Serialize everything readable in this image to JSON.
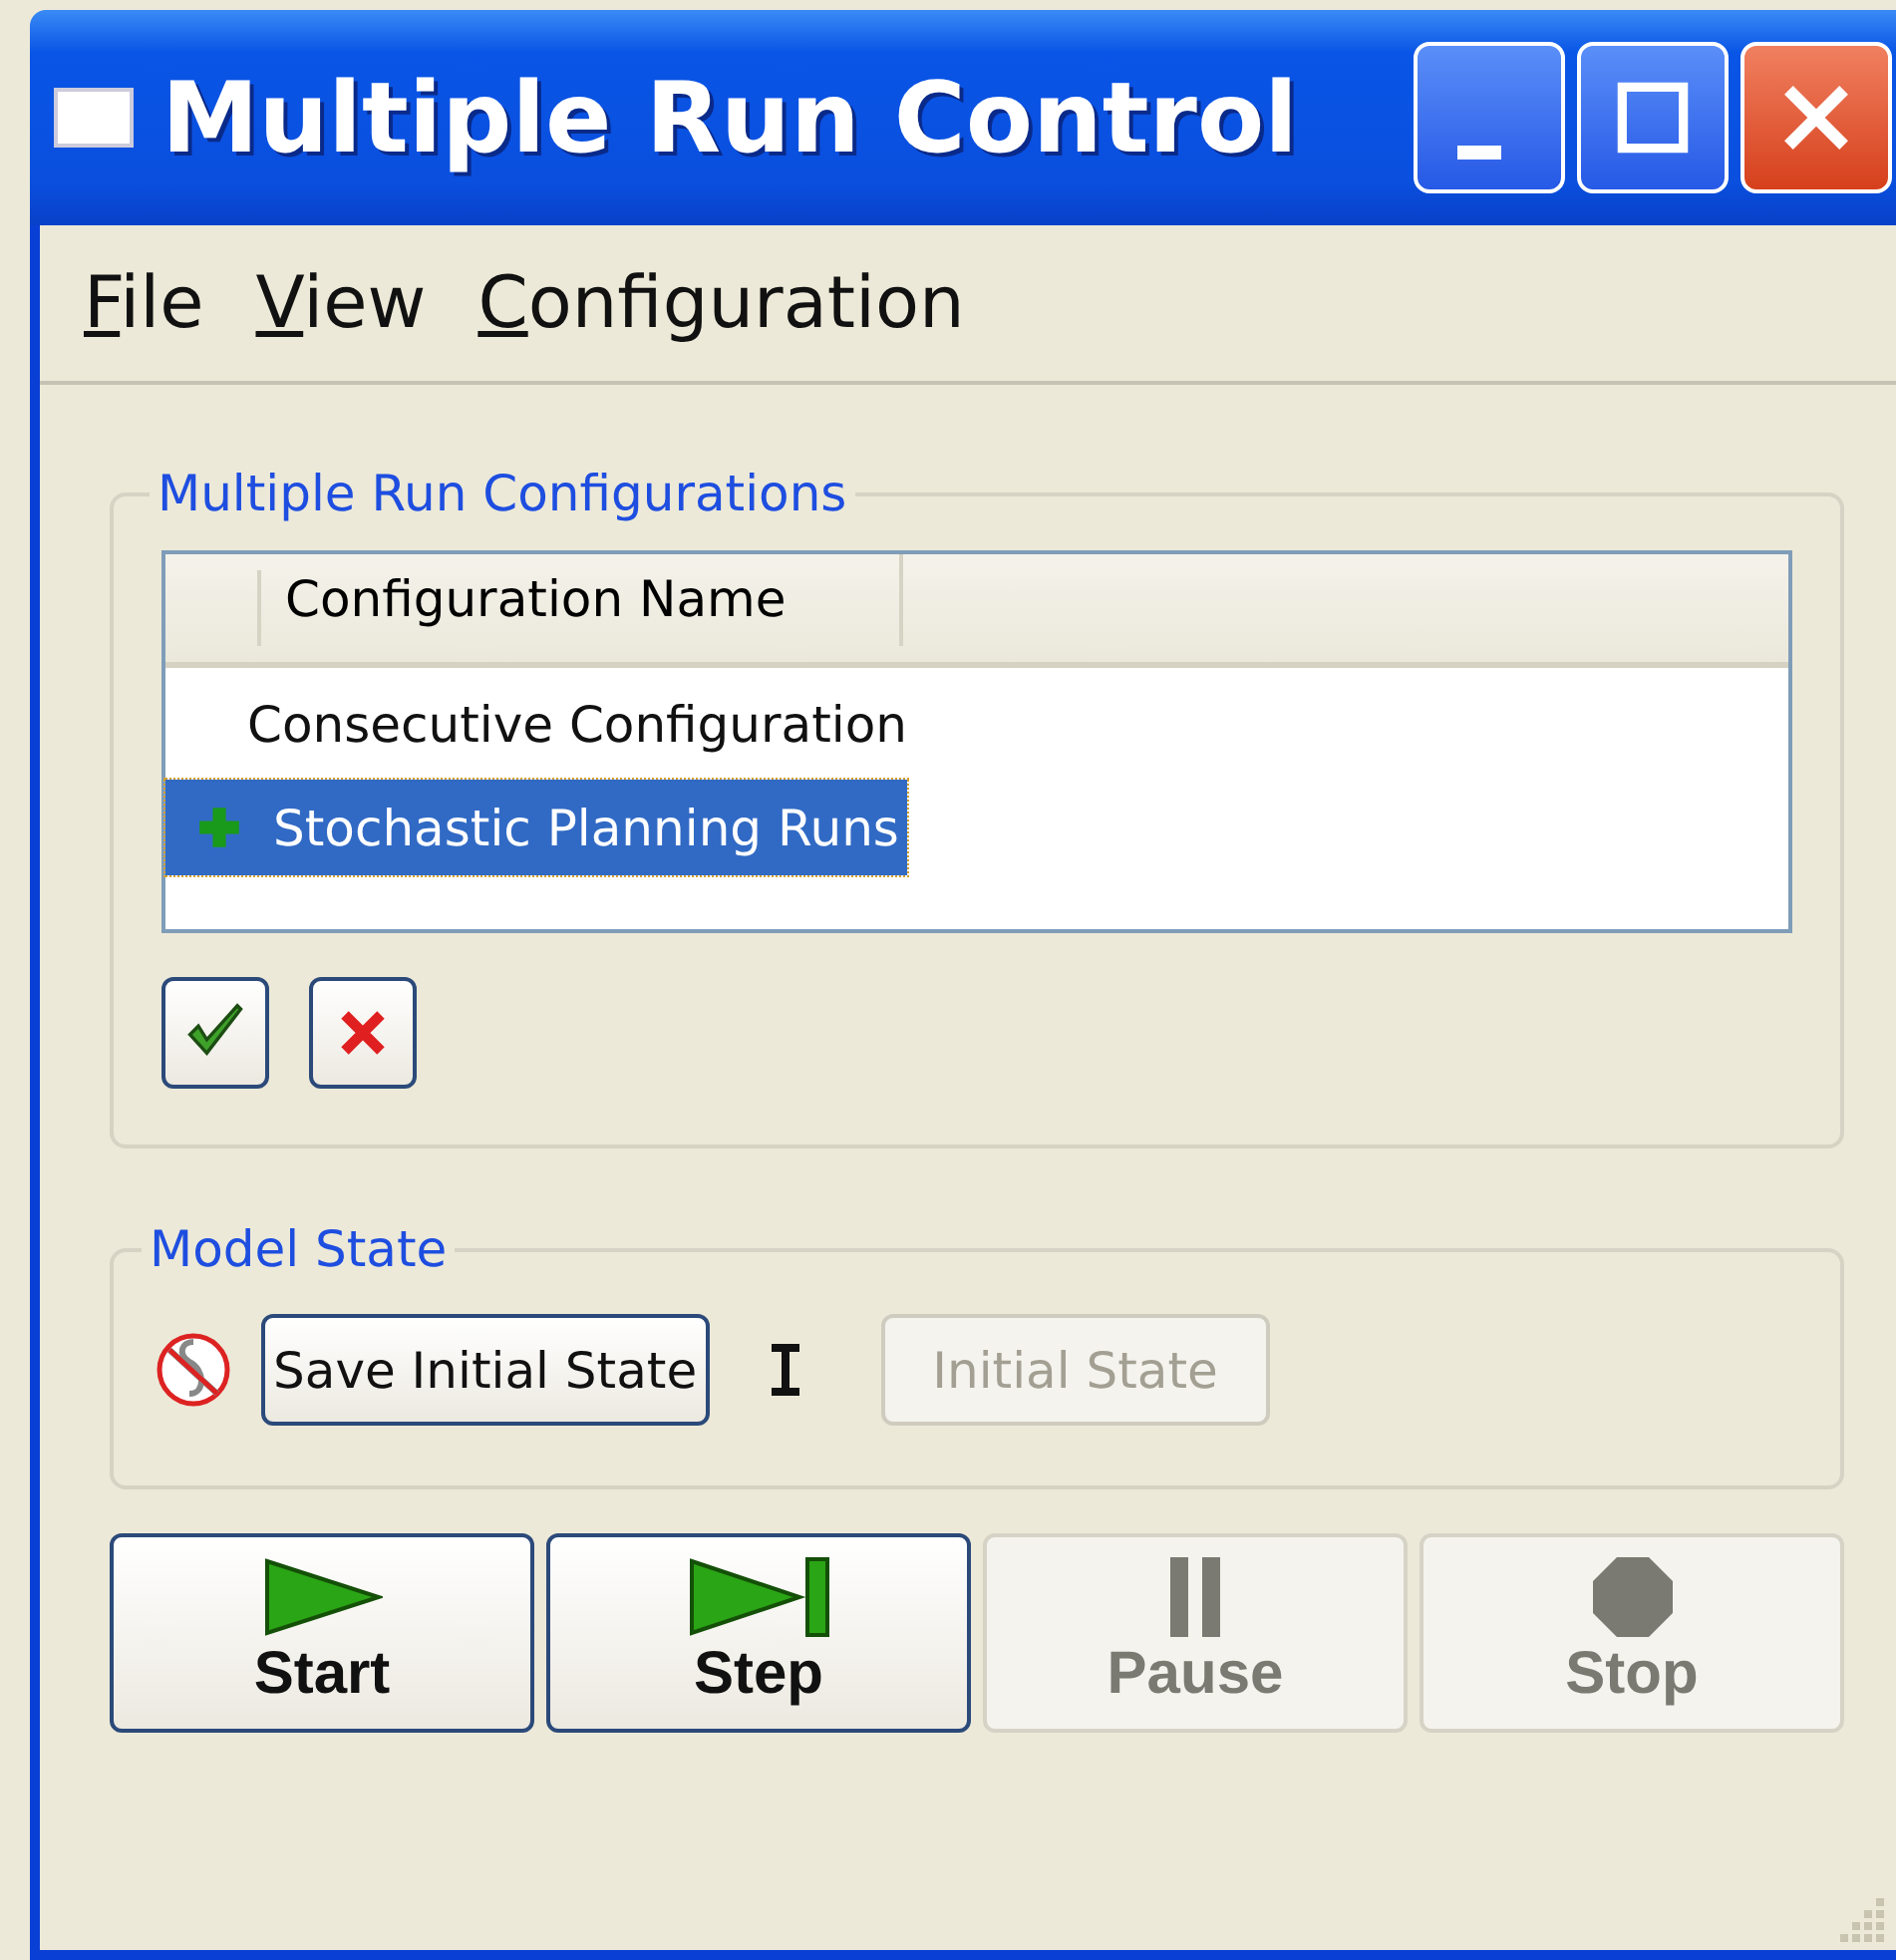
{
  "window": {
    "title": "Multiple Run Control"
  },
  "menu": [
    "File",
    "View",
    "Configuration"
  ],
  "configurations": {
    "title": "Multiple Run Configurations",
    "columns": [
      "Configuration Name"
    ],
    "rows": [
      {
        "name": "Consecutive Configuration",
        "selected": false,
        "added": false
      },
      {
        "name": "Stochastic Planning Runs",
        "selected": true,
        "added": true
      }
    ]
  },
  "model_state": {
    "title": "Model State",
    "save_button": "Save Initial State",
    "initial_state_button": {
      "label": "Initial State",
      "disabled": true
    }
  },
  "run_buttons": [
    {
      "kind": "start",
      "label": "Start",
      "disabled": false
    },
    {
      "kind": "step",
      "label": "Step",
      "disabled": false
    },
    {
      "kind": "pause",
      "label": "Pause",
      "disabled": true
    },
    {
      "kind": "stop",
      "label": "Stop",
      "disabled": true
    }
  ]
}
